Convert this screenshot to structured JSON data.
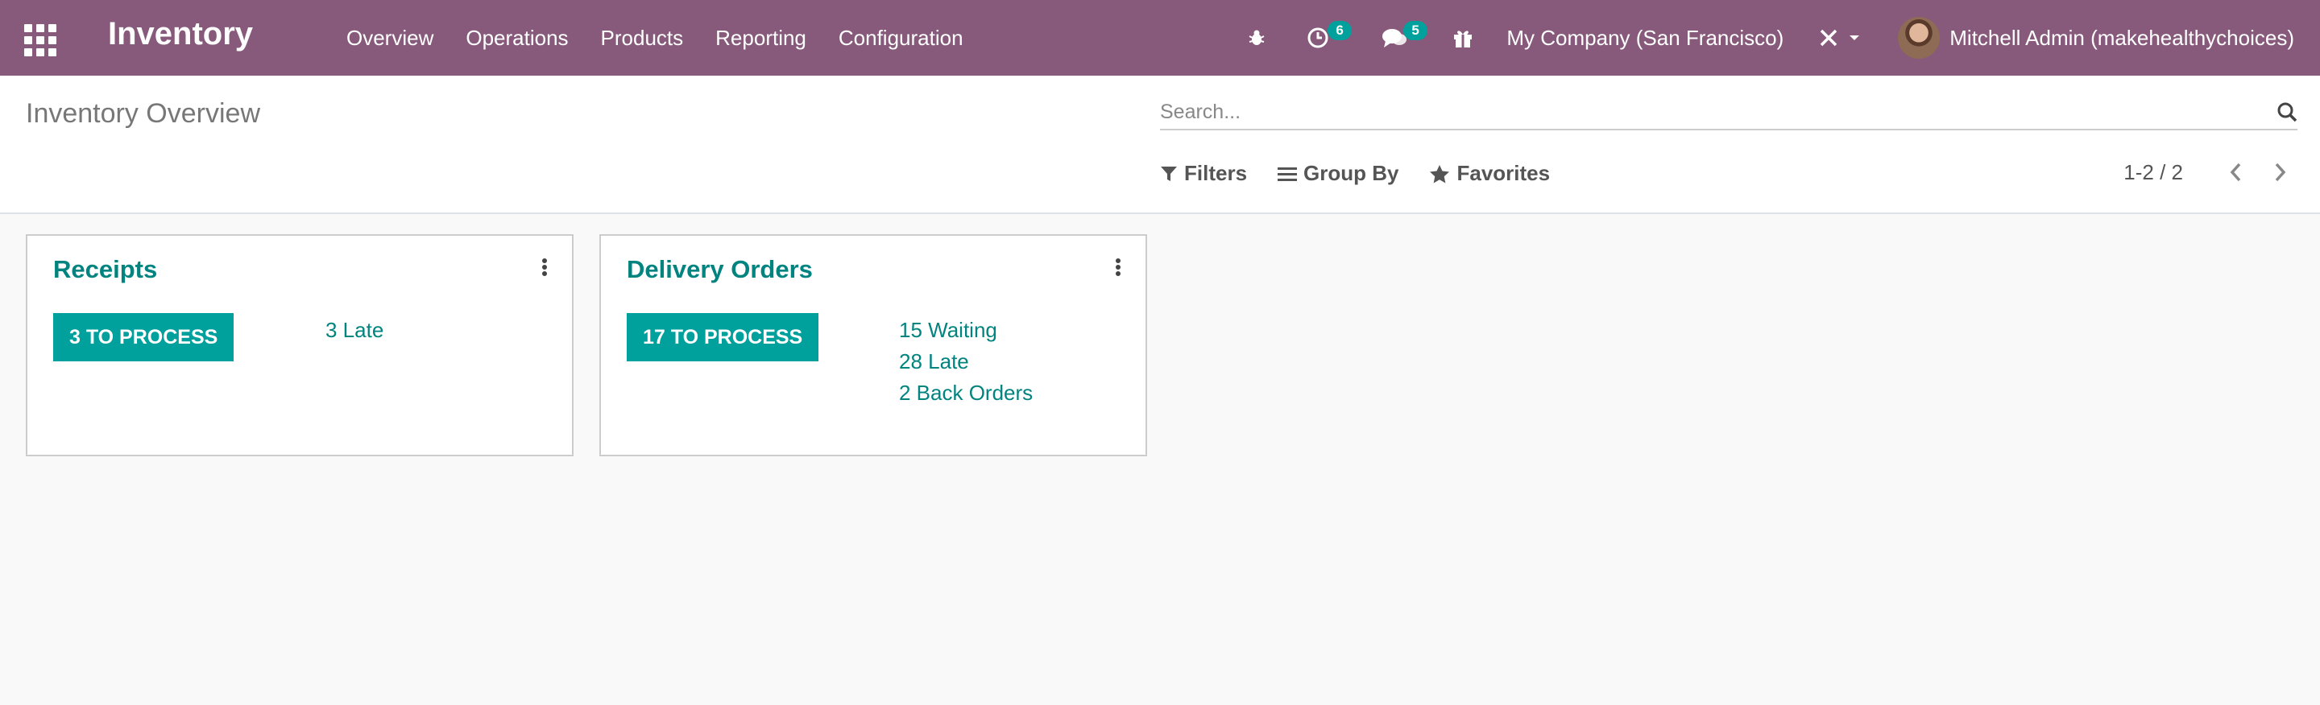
{
  "navbar": {
    "brand": "Inventory",
    "menu": [
      "Overview",
      "Operations",
      "Products",
      "Reporting",
      "Configuration"
    ],
    "activities_count": "6",
    "messages_count": "5",
    "company": "My Company (San Francisco)",
    "user": "Mitchell Admin (makehealthychoices)"
  },
  "control_panel": {
    "title": "Inventory Overview",
    "search_placeholder": "Search...",
    "filters_label": "Filters",
    "group_by_label": "Group By",
    "favorites_label": "Favorites",
    "pager": "1-2 / 2"
  },
  "cards": [
    {
      "title": "Receipts",
      "button": "3 TO PROCESS",
      "stats": [
        "3 Late"
      ]
    },
    {
      "title": "Delivery Orders",
      "button": "17 TO PROCESS",
      "stats": [
        "15 Waiting",
        "28 Late",
        "2 Back Orders"
      ]
    }
  ],
  "colors": {
    "navbar": "#875a7b",
    "accent": "#00a09d",
    "link": "#01847f"
  },
  "icons": [
    "apps-icon",
    "bug-icon",
    "activity-clock-icon",
    "chat-icon",
    "gift-icon",
    "tools-icon",
    "search-icon",
    "filter-icon",
    "list-icon",
    "star-icon",
    "chevron-left-icon",
    "chevron-right-icon",
    "kebab-menu-icon"
  ]
}
